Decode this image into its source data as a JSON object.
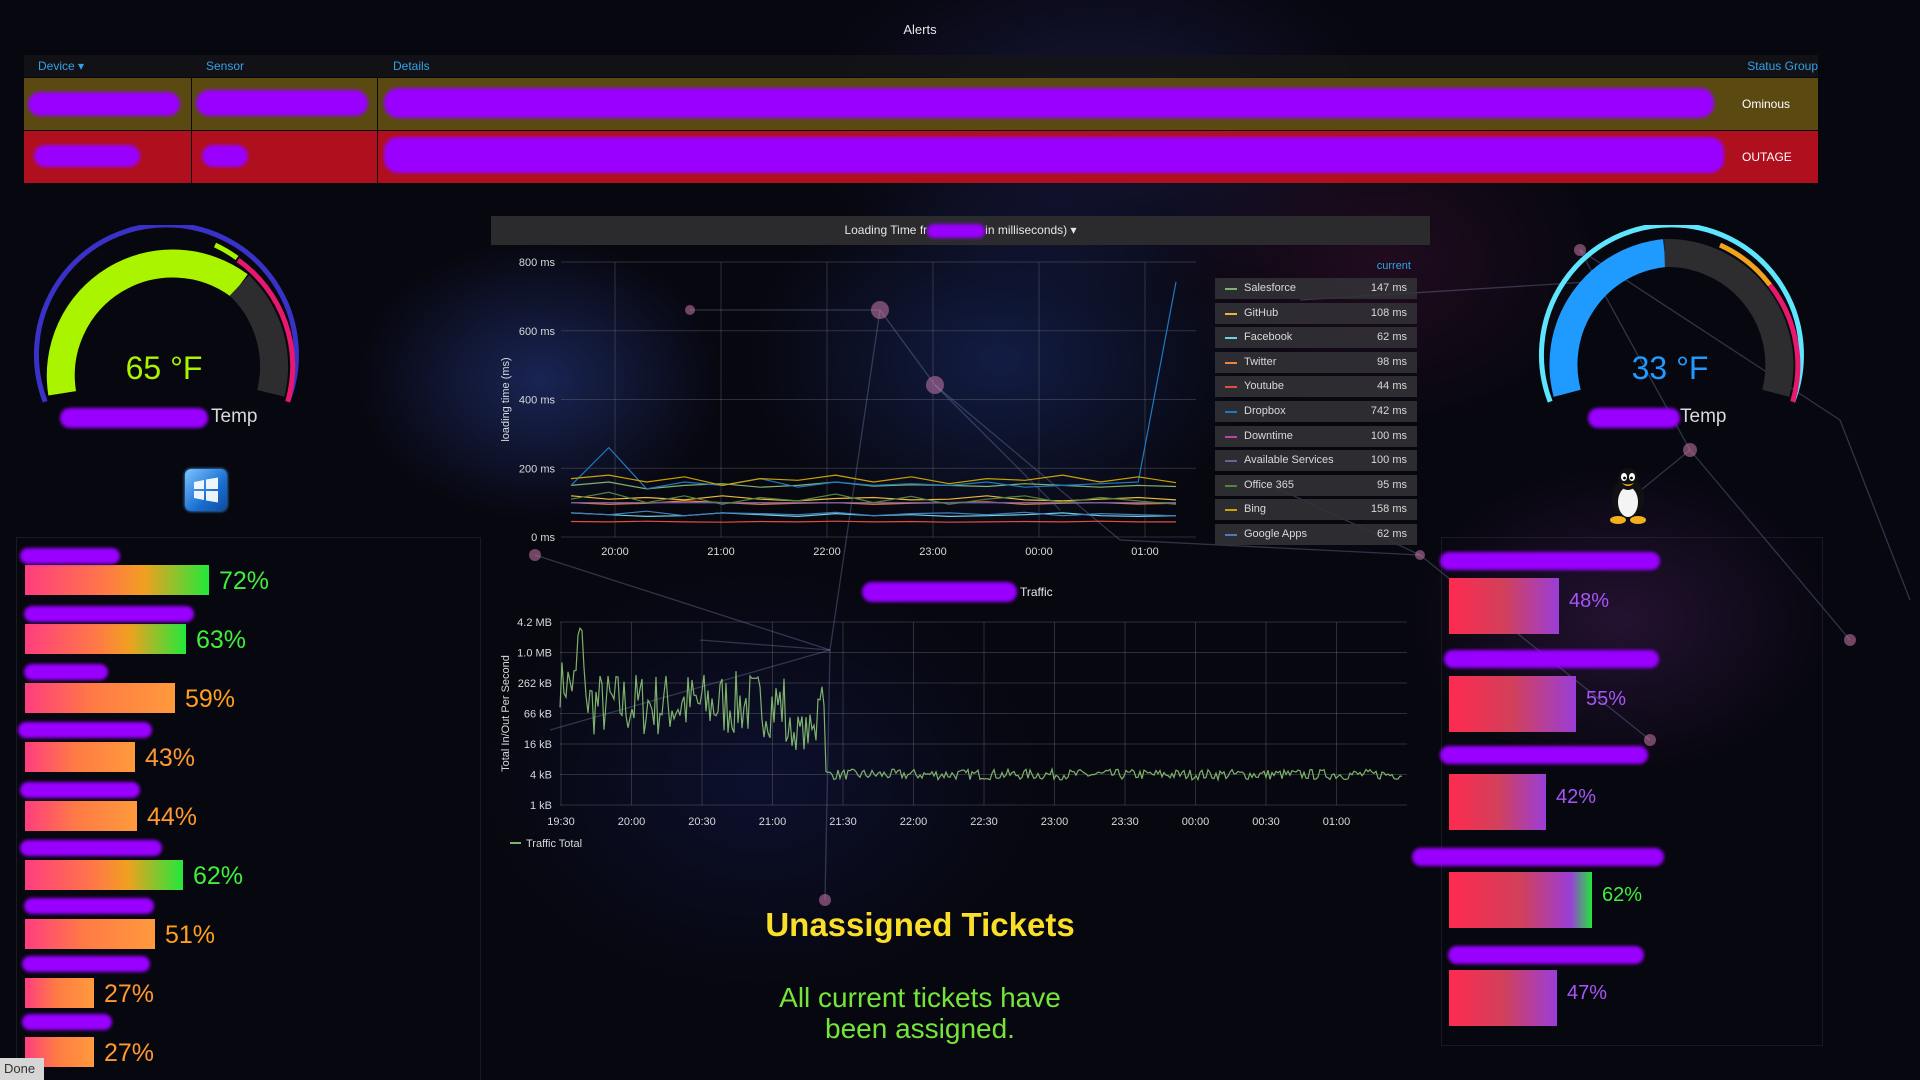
{
  "alerts": {
    "title": "Alerts",
    "columns": {
      "device": "Device",
      "sensor": "Sensor",
      "details": "Details",
      "status_group": "Status Group"
    },
    "sort_indicator": "▾",
    "rows": [
      {
        "status": "Ominous",
        "color": "#5a4a12"
      },
      {
        "status": "OUTAGE",
        "color": "#b0101e"
      }
    ]
  },
  "gauge_left": {
    "value": "65 °F",
    "label": "Temp",
    "color": "#aaf400"
  },
  "gauge_right": {
    "value": "33 °F",
    "label": "Temp",
    "color": "#1f9bff"
  },
  "os_icons": {
    "left": "windows-icon",
    "right": "linux-tux-icon"
  },
  "left_bars": [
    {
      "pct": "72%",
      "value": 72
    },
    {
      "pct": "63%",
      "value": 63
    },
    {
      "pct": "59%",
      "value": 59
    },
    {
      "pct": "43%",
      "value": 43
    },
    {
      "pct": "44%",
      "value": 44
    },
    {
      "pct": "62%",
      "value": 62
    },
    {
      "pct": "51%",
      "value": 51
    },
    {
      "pct": "27%",
      "value": 27
    },
    {
      "pct": "27%",
      "value": 27
    }
  ],
  "right_bars": [
    {
      "pct": "48%",
      "value": 48
    },
    {
      "pct": "55%",
      "value": 55
    },
    {
      "pct": "42%",
      "value": 42
    },
    {
      "pct": "62%",
      "value": 62
    },
    {
      "pct": "47%",
      "value": 47
    }
  ],
  "loading_panel": {
    "title_prefix": "Loading Time fr",
    "title_suffix": "in milliseconds)",
    "dropdown_caret": "▾",
    "legend_header": "current"
  },
  "traffic_panel": {
    "title": "Traffic"
  },
  "tickets": {
    "title": "Unassigned Tickets",
    "message_line1": "All current tickets have",
    "message_line2": "been assigned."
  },
  "statusbar": {
    "text": "Done"
  },
  "chart_data": [
    {
      "type": "line",
      "title": "",
      "ylabel": "loading time (ms)",
      "ylim": [
        0,
        800
      ],
      "y_ticks": [
        "0 ms",
        "200 ms",
        "400 ms",
        "600 ms",
        "800 ms"
      ],
      "x_ticks": [
        "20:00",
        "21:00",
        "22:00",
        "23:00",
        "00:00",
        "01:00"
      ],
      "legend_placement": "right",
      "series": [
        {
          "name": "Salesforce",
          "current": "147 ms",
          "color": "#7eb26d",
          "values": [
            150,
            160,
            140,
            150,
            155,
            145,
            150,
            160,
            148,
            152,
            150,
            147,
            155,
            150,
            145,
            150,
            147
          ]
        },
        {
          "name": "GitHub",
          "current": "108 ms",
          "color": "#eab839",
          "values": [
            120,
            110,
            115,
            108,
            120,
            110,
            105,
            112,
            115,
            108,
            110,
            120,
            108,
            105,
            110,
            115,
            108
          ]
        },
        {
          "name": "Facebook",
          "current": "62 ms",
          "color": "#6ed0e0",
          "values": [
            70,
            65,
            60,
            62,
            70,
            65,
            60,
            68,
            62,
            65,
            60,
            62,
            65,
            70,
            62,
            60,
            62
          ]
        },
        {
          "name": "Twitter",
          "current": "98 ms",
          "color": "#ef843c",
          "values": [
            100,
            95,
            98,
            105,
            100,
            95,
            98,
            100,
            95,
            98,
            100,
            102,
            95,
            98,
            100,
            96,
            98
          ]
        },
        {
          "name": "Youtube",
          "current": "44 ms",
          "color": "#e24d42",
          "values": [
            45,
            44,
            46,
            44,
            43,
            45,
            44,
            46,
            44,
            45,
            43,
            44,
            45,
            44,
            46,
            44,
            44
          ]
        },
        {
          "name": "Dropbox",
          "current": "742 ms",
          "color": "#1f78c1",
          "values": [
            150,
            260,
            140,
            160,
            150,
            170,
            145,
            160,
            150,
            155,
            150,
            160,
            145,
            150,
            155,
            160,
            742
          ]
        },
        {
          "name": "Downtime",
          "current": "100 ms",
          "color": "#ba43a9",
          "values": [
            100,
            100,
            100,
            100,
            100,
            100,
            100,
            100,
            100,
            100,
            100,
            100,
            100,
            100,
            100,
            100,
            100
          ]
        },
        {
          "name": "Available Services",
          "current": "100 ms",
          "color": "#705da0",
          "values": [
            100,
            100,
            100,
            100,
            100,
            100,
            100,
            100,
            100,
            100,
            100,
            100,
            100,
            100,
            100,
            100,
            100
          ]
        },
        {
          "name": "Office 365",
          "current": "95 ms",
          "color": "#508642",
          "values": [
            110,
            130,
            100,
            120,
            95,
            115,
            105,
            125,
            100,
            118,
            95,
            110,
            120,
            100,
            115,
            105,
            95
          ]
        },
        {
          "name": "Bing",
          "current": "158 ms",
          "color": "#cca300",
          "values": [
            170,
            180,
            160,
            175,
            150,
            170,
            165,
            180,
            160,
            175,
            155,
            170,
            165,
            180,
            160,
            175,
            158
          ]
        },
        {
          "name": "Google Apps",
          "current": "62 ms",
          "color": "#447ebc",
          "values": [
            70,
            65,
            75,
            62,
            70,
            68,
            65,
            72,
            62,
            68,
            70,
            65,
            72,
            62,
            68,
            65,
            62
          ]
        }
      ]
    },
    {
      "type": "line",
      "title": "Traffic",
      "ylabel": "Total In/Out Per Second",
      "y_scale": "log",
      "y_ticks": [
        "1 kB",
        "4 kB",
        "16 kB",
        "66 kB",
        "262 kB",
        "1.0 MB",
        "4.2 MB"
      ],
      "x_ticks": [
        "19:30",
        "20:00",
        "20:30",
        "21:00",
        "21:30",
        "22:00",
        "22:30",
        "23:00",
        "23:30",
        "00:00",
        "00:30",
        "01:00"
      ],
      "legend_placement": "bottom-left",
      "series": [
        {
          "name": "Traffic Total",
          "color": "#7eb26d"
        }
      ]
    }
  ]
}
